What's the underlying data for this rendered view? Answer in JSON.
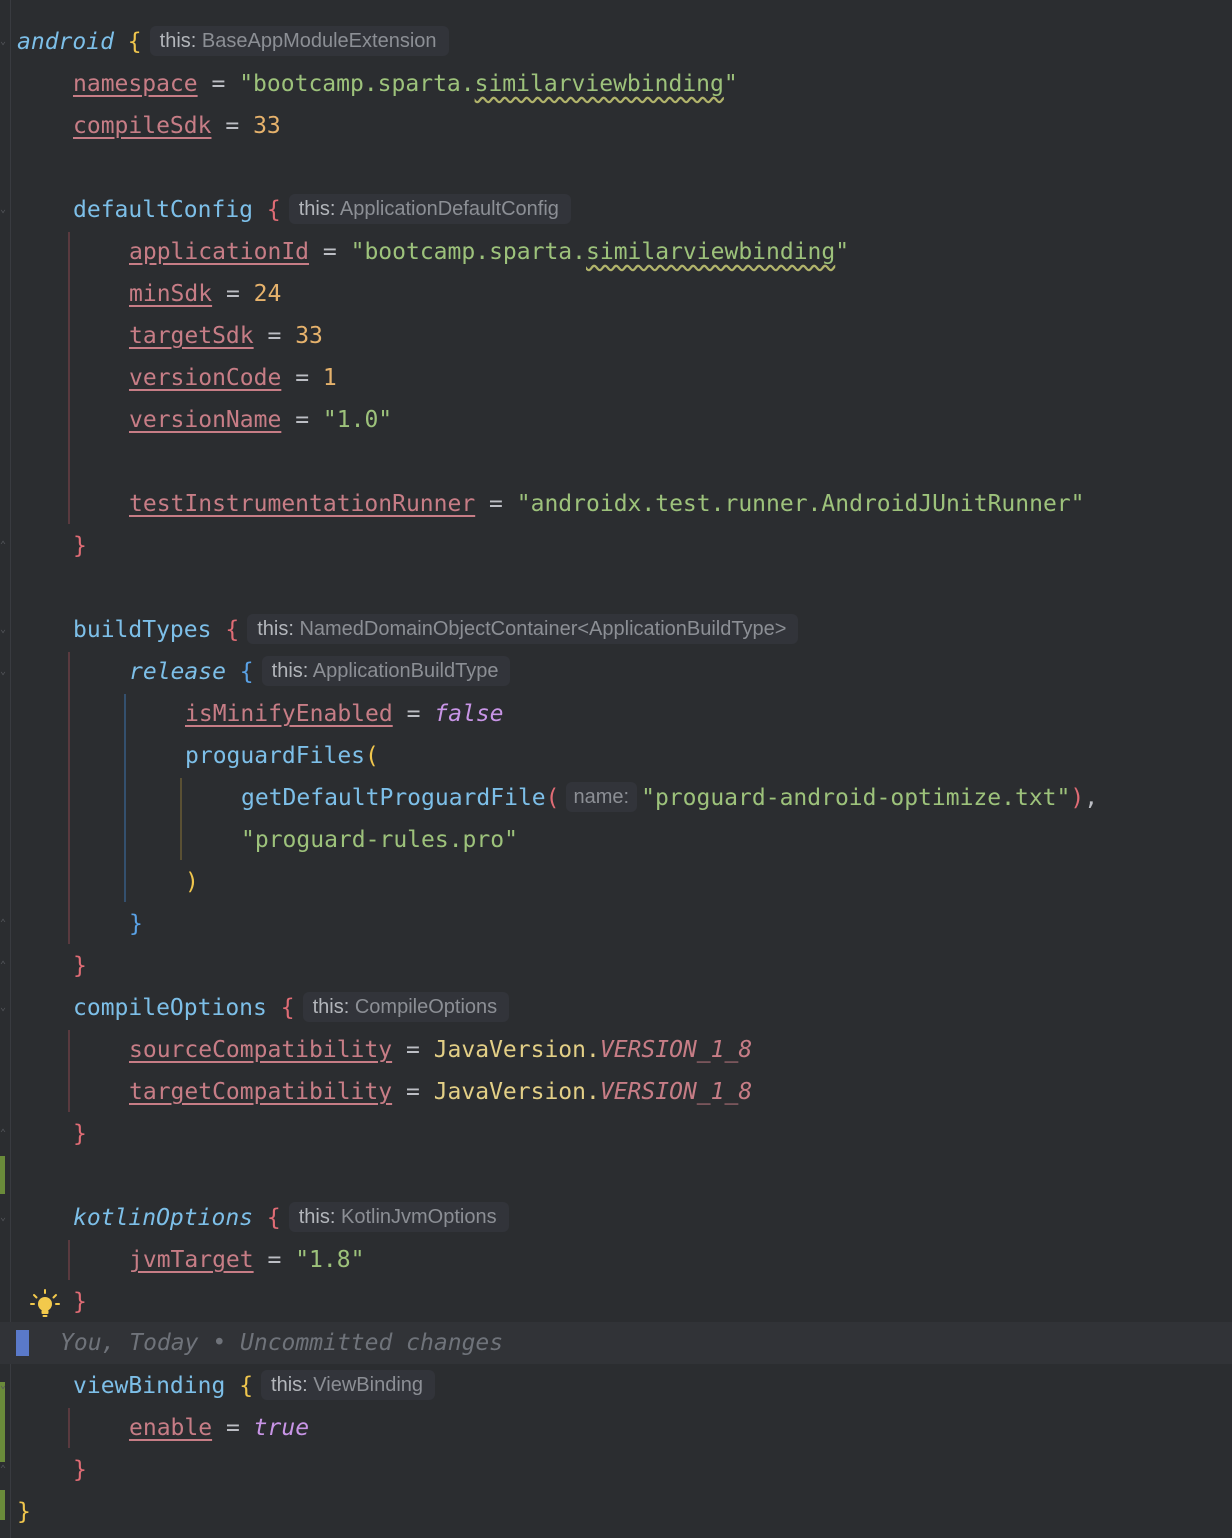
{
  "editor": {
    "blame": "You, Today • Uncommitted changes",
    "hints": {
      "android": "BaseAppModuleExtension",
      "defaultConfig": "ApplicationDefaultConfig",
      "buildTypes": "NamedDomainObjectContainer<ApplicationBuildType>",
      "release": "ApplicationBuildType",
      "compileOptions": "CompileOptions",
      "kotlinOptions": "KotlinJvmOptions",
      "viewBinding": "ViewBinding",
      "this_label": "this:",
      "param_name": "name:"
    },
    "code": {
      "android": "android",
      "namespace": "namespace",
      "namespace_val_a": "\"bootcamp.sparta.",
      "namespace_val_b": "similarviewbinding",
      "namespace_val_c": "\"",
      "compileSdk": "compileSdk",
      "compileSdk_val": "33",
      "defaultConfig": "defaultConfig",
      "applicationId": "applicationId",
      "applicationId_val_a": "\"bootcamp.sparta.",
      "applicationId_val_b": "similarviewbinding",
      "applicationId_val_c": "\"",
      "minSdk": "minSdk",
      "minSdk_val": "24",
      "targetSdk": "targetSdk",
      "targetSdk_val": "33",
      "versionCode": "versionCode",
      "versionCode_val": "1",
      "versionName": "versionName",
      "versionName_val": "\"1.0\"",
      "testRunner": "testInstrumentationRunner",
      "testRunner_val": "\"androidx.test.runner.AndroidJUnitRunner\"",
      "buildTypes": "buildTypes",
      "release": "release",
      "isMinifyEnabled": "isMinifyEnabled",
      "false_kw": "false",
      "proguardFiles": "proguardFiles",
      "getDefault": "getDefaultProguardFile",
      "proguard_opt": "\"proguard-android-optimize.txt\"",
      "proguard_rules": "\"proguard-rules.pro\"",
      "compileOptions": "compileOptions",
      "sourceCompat": "sourceCompatibility",
      "targetCompat": "targetCompatibility",
      "javaVersion": "JavaVersion.",
      "version18": "VERSION_1_8",
      "kotlinOptions": "kotlinOptions",
      "jvmTarget": "jvmTarget",
      "jvmTarget_val": "\"1.8\"",
      "viewBinding": "viewBinding",
      "enable": "enable",
      "true_kw": "true"
    }
  }
}
